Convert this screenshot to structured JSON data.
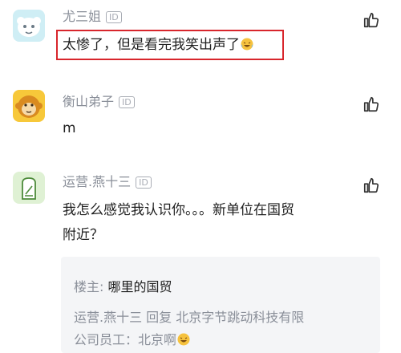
{
  "comments": [
    {
      "username": "尤三姐",
      "id_badge": "ID",
      "text": "太惨了，但是看完我笑出声了",
      "emoji_icon": "laughing-tears-emoji",
      "highlight_color": "#d8262c"
    },
    {
      "username": "衡山弟子",
      "id_badge": "ID",
      "text": "m"
    },
    {
      "username": "运营.燕十三",
      "id_badge": "ID",
      "text_line1": "我怎么感觉我认识你。。。新单位在国贸",
      "text_line2": "附近？",
      "reply": {
        "author_label": "楼主:",
        "author_text": "哪里的国贸",
        "reply_prefix": "运营.燕十三 回复 北京字节跳动科技有限",
        "reply_line2": "公司员工：北京啊"
      }
    }
  ],
  "colors": {
    "username": "#8a8f99",
    "text": "#1f1f1f",
    "reply_bg": "#f4f5f7"
  }
}
